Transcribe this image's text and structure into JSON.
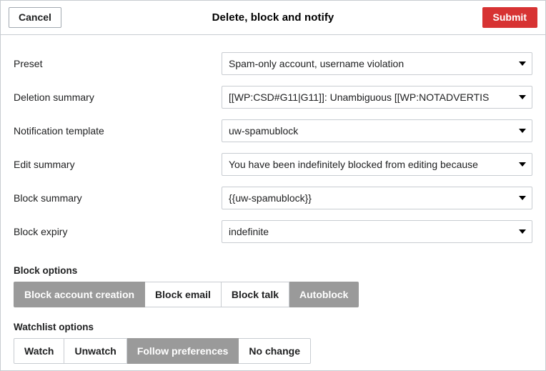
{
  "header": {
    "cancel_label": "Cancel",
    "title": "Delete, block and notify",
    "submit_label": "Submit",
    "submit_color": "#d73333"
  },
  "fields": [
    {
      "label": "Preset",
      "value": "Spam-only account, username violation",
      "name": "preset"
    },
    {
      "label": "Deletion summary",
      "value": "[[WP:CSD#G11|G11]]: Unambiguous [[WP:NOTADVERTIS",
      "name": "deletion-summary"
    },
    {
      "label": "Notification template",
      "value": "uw-spamublock",
      "name": "notification-template"
    },
    {
      "label": "Edit summary",
      "value": "You have been indefinitely blocked from editing because",
      "name": "edit-summary"
    },
    {
      "label": "Block summary",
      "value": "{{uw-spamublock}}",
      "name": "block-summary"
    },
    {
      "label": "Block expiry",
      "value": "indefinite",
      "name": "block-expiry"
    }
  ],
  "block_options": {
    "heading": "Block options",
    "selected_color": "#9a9a9a",
    "buttons": [
      {
        "label": "Block account creation",
        "selected": true
      },
      {
        "label": "Block email",
        "selected": false
      },
      {
        "label": "Block talk",
        "selected": false
      },
      {
        "label": "Autoblock",
        "selected": true
      }
    ]
  },
  "watchlist_options": {
    "heading": "Watchlist options",
    "selected_color": "#9a9a9a",
    "buttons": [
      {
        "label": "Watch",
        "selected": false
      },
      {
        "label": "Unwatch",
        "selected": false
      },
      {
        "label": "Follow preferences",
        "selected": true
      },
      {
        "label": "No change",
        "selected": false
      }
    ]
  },
  "icons": {
    "caret": "chevron-down-icon"
  }
}
